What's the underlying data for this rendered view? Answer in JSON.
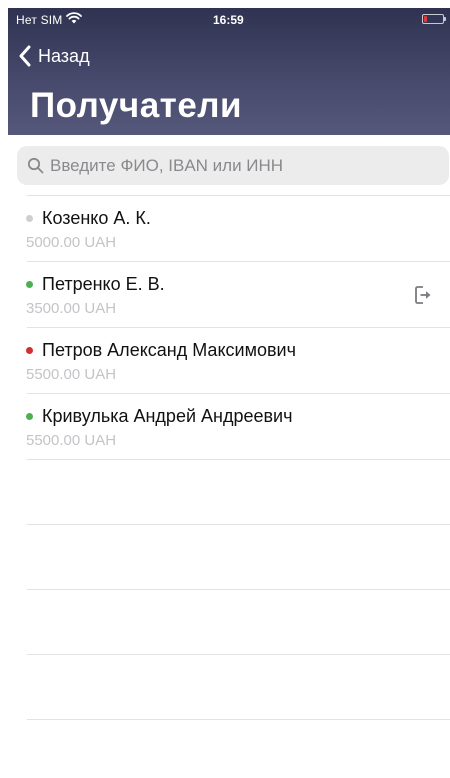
{
  "status_bar": {
    "carrier": "Нет SIM",
    "time": "16:59"
  },
  "nav": {
    "back_label": "Назад",
    "title": "Получатели"
  },
  "search": {
    "placeholder": "Введите ФИО, IBAN или ИНН",
    "value": ""
  },
  "colors": {
    "header_top": "#2f3250",
    "header_bottom": "#55587a",
    "status_active": "#4caf50",
    "status_inactive": "#cfcfd3",
    "status_error": "#d32f2f",
    "battery_low": "#e53935"
  },
  "recipients": [
    {
      "name": "Козенко А. К.",
      "amount": "5000.00 UAH",
      "status_color": "#cfcfd3",
      "action_icon": ""
    },
    {
      "name": "Петренко Е. В.",
      "amount": "3500.00 UAH",
      "status_color": "#4caf50",
      "action_icon": "logout-arrow-icon"
    },
    {
      "name": "Петров Александ Максимович",
      "amount": "5500.00 UAH",
      "status_color": "#d32f2f",
      "action_icon": ""
    },
    {
      "name": "Кривулька Андрей Андреевич",
      "amount": "5500.00 UAH",
      "status_color": "#4caf50",
      "action_icon": ""
    }
  ]
}
